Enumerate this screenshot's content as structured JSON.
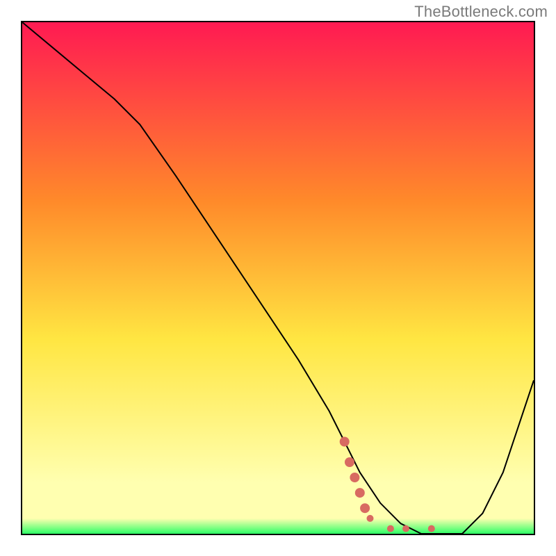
{
  "watermark": "TheBottleneck.com",
  "colors": {
    "gradient_top": "#ff1a52",
    "gradient_mid1": "#ff8a2a",
    "gradient_mid2": "#ffe642",
    "gradient_bottom_yellow": "#ffffb0",
    "gradient_green": "#2dff66",
    "curve": "#000000",
    "marker": "#d86a61"
  },
  "chart_data": {
    "type": "line",
    "title": "",
    "xlabel": "",
    "ylabel": "",
    "xlim": [
      0,
      100
    ],
    "ylim": [
      0,
      100
    ],
    "grid": false,
    "legend": false,
    "x": [
      0,
      6,
      12,
      18,
      23,
      30,
      38,
      46,
      54,
      60,
      63,
      66,
      70,
      74,
      78,
      82,
      86,
      90,
      94,
      100
    ],
    "values": [
      100,
      95,
      90,
      85,
      80,
      70,
      58,
      46,
      34,
      24,
      18,
      12,
      6,
      2,
      0,
      0,
      0,
      4,
      12,
      30
    ],
    "markers": {
      "x": [
        63,
        64,
        65,
        66,
        67,
        68,
        72,
        75,
        80
      ],
      "values": [
        18,
        14,
        11,
        8,
        5,
        3,
        1,
        1,
        1
      ]
    }
  }
}
